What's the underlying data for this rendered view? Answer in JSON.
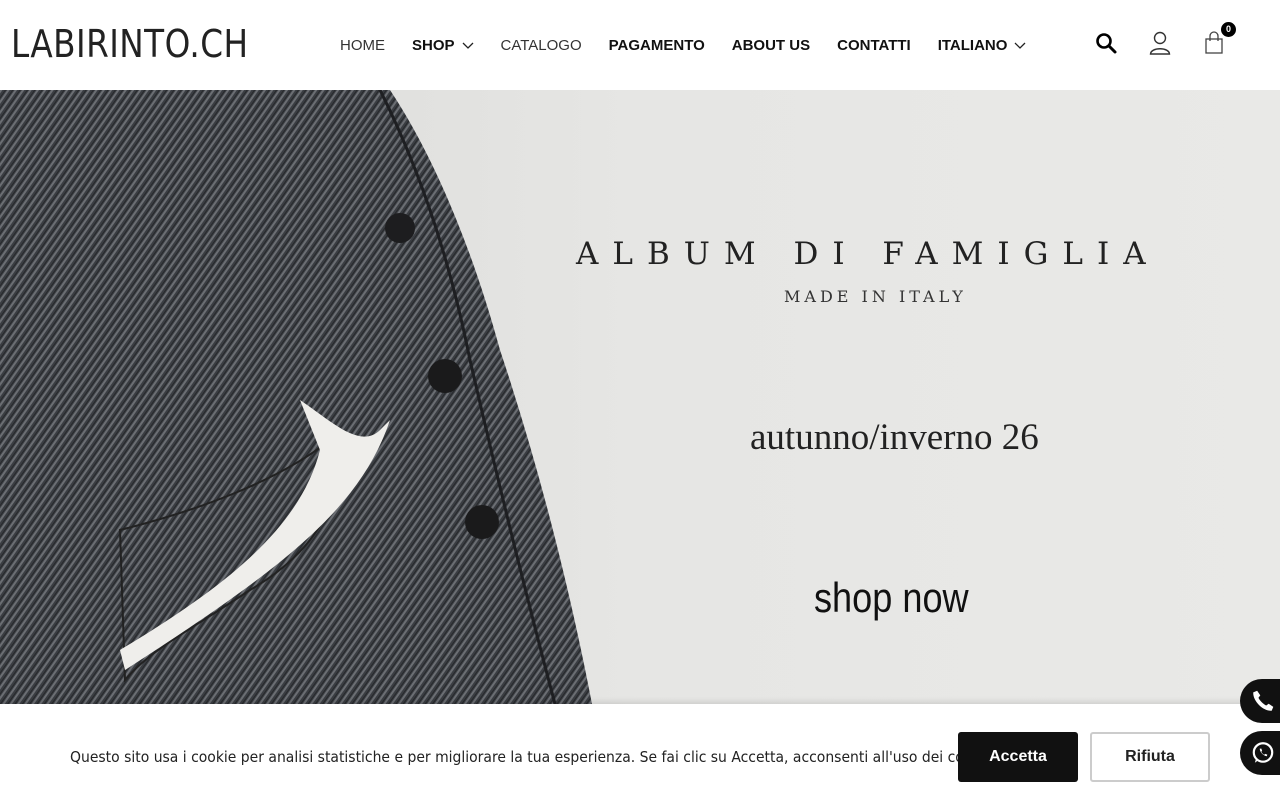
{
  "header": {
    "logo": "LABIRINTO.CH",
    "nav": [
      {
        "label": "HOME"
      },
      {
        "label": "SHOP"
      },
      {
        "label": "CATALOGO"
      },
      {
        "label": "PAGAMENTO"
      },
      {
        "label": "ABOUT US"
      },
      {
        "label": "CONTATTI"
      },
      {
        "label": "ITALIANO"
      }
    ],
    "cart_count": "0",
    "icons": [
      "search-icon",
      "user-icon",
      "cart-icon"
    ]
  },
  "hero": {
    "title": "ALBUM DI FAMIGLIA",
    "subtitle": "MADE IN ITALY",
    "season": "autunno/inverno 26",
    "cta": "shop now"
  },
  "cookie": {
    "text": "Questo sito usa i cookie per analisi statistiche e per migliorare la tua esperienza. Se fai clic su Accetta, acconsenti all'uso dei cookie.",
    "accept_label": "Accetta",
    "reject_label": "Rifiuta"
  },
  "floating": {
    "icons": [
      "phone-icon",
      "whatsapp-icon"
    ]
  },
  "colors": {
    "primary": "#111111",
    "hero_bg": "#e3e3e1"
  }
}
